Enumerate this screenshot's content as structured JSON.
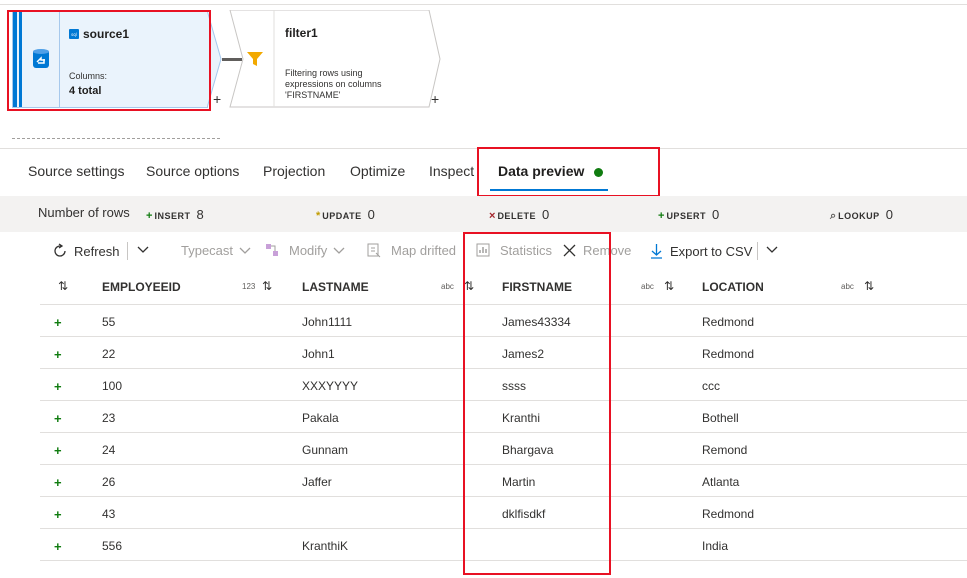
{
  "pipeline": {
    "source": {
      "title": "source1",
      "columns_label": "Columns:",
      "columns_total": "4 total"
    },
    "filter": {
      "title": "filter1",
      "desc_line1": "Filtering rows using",
      "desc_line2": "expressions on columns",
      "desc_line3": "'FIRSTNAME'"
    },
    "add_symbol": "+"
  },
  "tabs": [
    {
      "label": "Source settings"
    },
    {
      "label": "Source options"
    },
    {
      "label": "Projection"
    },
    {
      "label": "Optimize"
    },
    {
      "label": "Inspect"
    },
    {
      "label": "Data preview",
      "active": true,
      "status_color": "#107c10"
    }
  ],
  "row_counts": {
    "label": "Number of rows",
    "insert": {
      "label": "INSERT",
      "value": "8",
      "icon": "+"
    },
    "update": {
      "label": "UPDATE",
      "value": "0",
      "icon": "*"
    },
    "delete": {
      "label": "DELETE",
      "value": "0",
      "icon": "×"
    },
    "upsert": {
      "label": "UPSERT",
      "value": "0",
      "icon": "+"
    },
    "lookup": {
      "label": "LOOKUP",
      "value": "0",
      "icon": "⌕"
    }
  },
  "toolbar": {
    "refresh": "Refresh",
    "typecast": "Typecast",
    "modify": "Modify",
    "map_drifted": "Map drifted",
    "statistics": "Statistics",
    "remove": "Remove",
    "export": "Export to CSV"
  },
  "table": {
    "columns": [
      {
        "name": "EMPLOYEEID",
        "type": "123"
      },
      {
        "name": "LASTNAME",
        "type": "abc"
      },
      {
        "name": "FIRSTNAME",
        "type": "abc"
      },
      {
        "name": "LOCATION",
        "type": "abc"
      }
    ],
    "rows": [
      [
        "55",
        "John1111",
        "James43334",
        "Redmond"
      ],
      [
        "22",
        "John1",
        "James2",
        "Redmond"
      ],
      [
        "100",
        "XXXYYYY",
        "ssss",
        "ccc"
      ],
      [
        "23",
        "Pakala",
        "Kranthi",
        "Bothell"
      ],
      [
        "24",
        "Gunnam",
        "Bhargava",
        "Remond"
      ],
      [
        "26",
        "Jaffer",
        "Martin",
        "Atlanta"
      ],
      [
        "43",
        "",
        "dklfisdkf",
        "Redmond"
      ],
      [
        "556",
        "KranthiK",
        "",
        "India"
      ]
    ],
    "row_marker": "+"
  },
  "colors": {
    "accent": "#0078d4",
    "insert": "#107c10",
    "highlight": "#e81123",
    "update": "#c19c00",
    "delete": "#a4262c"
  }
}
